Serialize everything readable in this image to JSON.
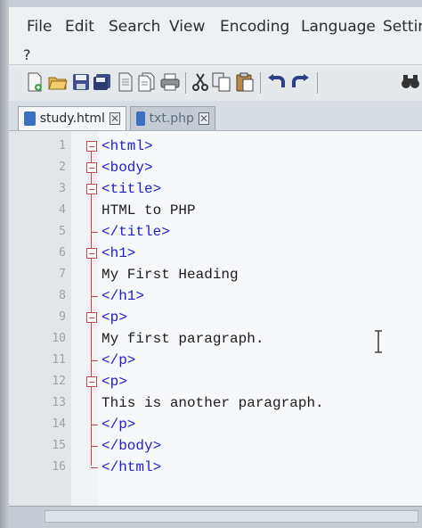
{
  "menu": {
    "items": [
      "File",
      "Edit",
      "Search",
      "View",
      "Encoding",
      "Language",
      "Settin"
    ],
    "overflow": "?"
  },
  "toolbar": {
    "icons": [
      "new-file-icon",
      "open-file-icon",
      "save-icon",
      "save-all-icon",
      "close-icon",
      "close-all-icon",
      "print-icon",
      "cut-icon",
      "copy-icon",
      "paste-icon",
      "undo-icon",
      "redo-icon",
      "find-icon"
    ]
  },
  "tabs": [
    {
      "label": "study.html",
      "active": true,
      "icon_color": "#3b6fc2"
    },
    {
      "label": "txt.php",
      "active": false,
      "icon_color": "#3b6fc2"
    }
  ],
  "editor": {
    "lines": [
      {
        "num": "1",
        "text": "<html>",
        "kind": "tag"
      },
      {
        "num": "2",
        "text": "<body>",
        "kind": "tag"
      },
      {
        "num": "3",
        "text": "<title>",
        "kind": "tag"
      },
      {
        "num": "4",
        "text": "HTML to PHP",
        "kind": "text"
      },
      {
        "num": "5",
        "text": "</title>",
        "kind": "tag"
      },
      {
        "num": "6",
        "text": "<h1>",
        "kind": "tag"
      },
      {
        "num": "7",
        "text": "My First Heading",
        "kind": "text"
      },
      {
        "num": "8",
        "text": "</h1>",
        "kind": "tag"
      },
      {
        "num": "9",
        "text": "<p>",
        "kind": "tag"
      },
      {
        "num": "10",
        "text": "My first paragraph.",
        "kind": "text"
      },
      {
        "num": "11",
        "text": "</p>",
        "kind": "tag"
      },
      {
        "num": "12",
        "text": "<p>",
        "kind": "tag"
      },
      {
        "num": "13",
        "text": "This is another paragraph.",
        "kind": "text"
      },
      {
        "num": "14",
        "text": "</p>",
        "kind": "tag"
      },
      {
        "num": "15",
        "text": "</body>",
        "kind": "tag"
      },
      {
        "num": "16",
        "text": "</html>",
        "kind": "tag"
      }
    ]
  },
  "colors": {
    "tag": "#1d22c8",
    "text": "#1b1c1e",
    "fold": "#c8484d",
    "line_number": "#9aa2aa"
  }
}
